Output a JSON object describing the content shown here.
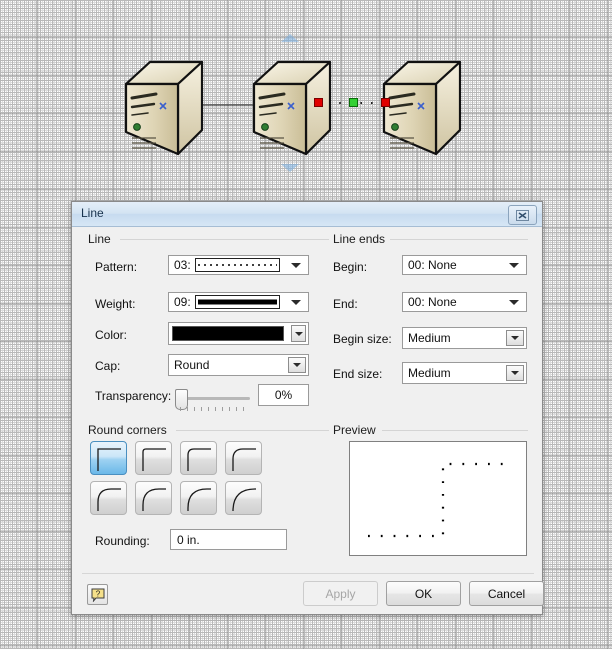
{
  "canvas": {
    "shapes": [
      {
        "name": "server-1",
        "label": "server"
      },
      {
        "name": "server-2",
        "label": "server"
      },
      {
        "name": "server-3",
        "label": "server"
      }
    ],
    "connectors": [
      {
        "name": "connector-solid",
        "style": "solid"
      },
      {
        "name": "connector-dotted-selected",
        "style": "dotted",
        "selected": true
      }
    ]
  },
  "dialog": {
    "title": "Line",
    "close_label": "✕",
    "line_group": {
      "title": "Line",
      "pattern_label": "Pattern:",
      "pattern_value": "03:",
      "weight_label": "Weight:",
      "weight_value": "09:",
      "color_label": "Color:",
      "color_value": "#000000",
      "cap_label": "Cap:",
      "cap_value": "Round",
      "transparency_label": "Transparency:",
      "transparency_value": "0%"
    },
    "line_ends_group": {
      "title": "Line ends",
      "begin_label": "Begin:",
      "begin_value": "00: None",
      "end_label": "End:",
      "end_value": "00: None",
      "begin_size_label": "Begin size:",
      "begin_size_value": "Medium",
      "end_size_label": "End size:",
      "end_size_value": "Medium"
    },
    "round_corners_group": {
      "title": "Round corners",
      "rounding_label": "Rounding:",
      "rounding_value": "0 in.",
      "selected_index": 0,
      "options": [
        {
          "name": "corner-option-1",
          "radius": 0
        },
        {
          "name": "corner-option-2",
          "radius": 3
        },
        {
          "name": "corner-option-3",
          "radius": 6
        },
        {
          "name": "corner-option-4",
          "radius": 10
        },
        {
          "name": "corner-option-5",
          "radius": 13
        },
        {
          "name": "corner-option-6",
          "radius": 16
        },
        {
          "name": "corner-option-7",
          "radius": 19
        },
        {
          "name": "corner-option-8",
          "radius": 22
        }
      ]
    },
    "preview_group": {
      "title": "Preview"
    },
    "footer": {
      "help_label": "?",
      "apply_label": "Apply",
      "apply_enabled": false,
      "ok_label": "OK",
      "cancel_label": "Cancel"
    }
  }
}
